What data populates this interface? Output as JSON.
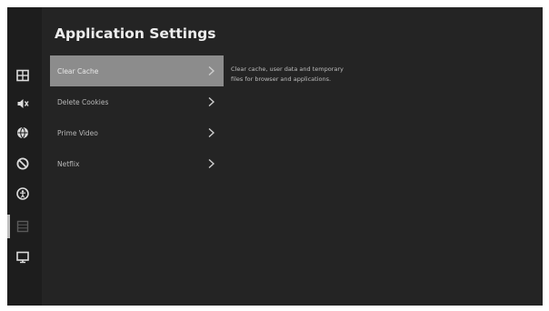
{
  "header": {
    "title": "Application Settings"
  },
  "sidebar": {
    "items": [
      {
        "icon": "picture-settings-icon"
      },
      {
        "icon": "sound-icon"
      },
      {
        "icon": "network-globe-icon"
      },
      {
        "icon": "restriction-icon"
      },
      {
        "icon": "accessibility-icon"
      },
      {
        "icon": "applications-grid-icon",
        "active": true
      },
      {
        "icon": "display-screen-icon"
      }
    ]
  },
  "menu": {
    "items": [
      {
        "label": "Clear Cache",
        "selected": true
      },
      {
        "label": "Delete Cookies",
        "selected": false
      },
      {
        "label": "Prime Video",
        "selected": false
      },
      {
        "label": "Netflix",
        "selected": false
      }
    ]
  },
  "description": {
    "text": "Clear cache, user data and temporary files for browser and applications."
  },
  "colors": {
    "background": "#242424",
    "sidebar": "#1d1d1d",
    "selected_item": "#8c8c8c",
    "text": "#ededed"
  }
}
